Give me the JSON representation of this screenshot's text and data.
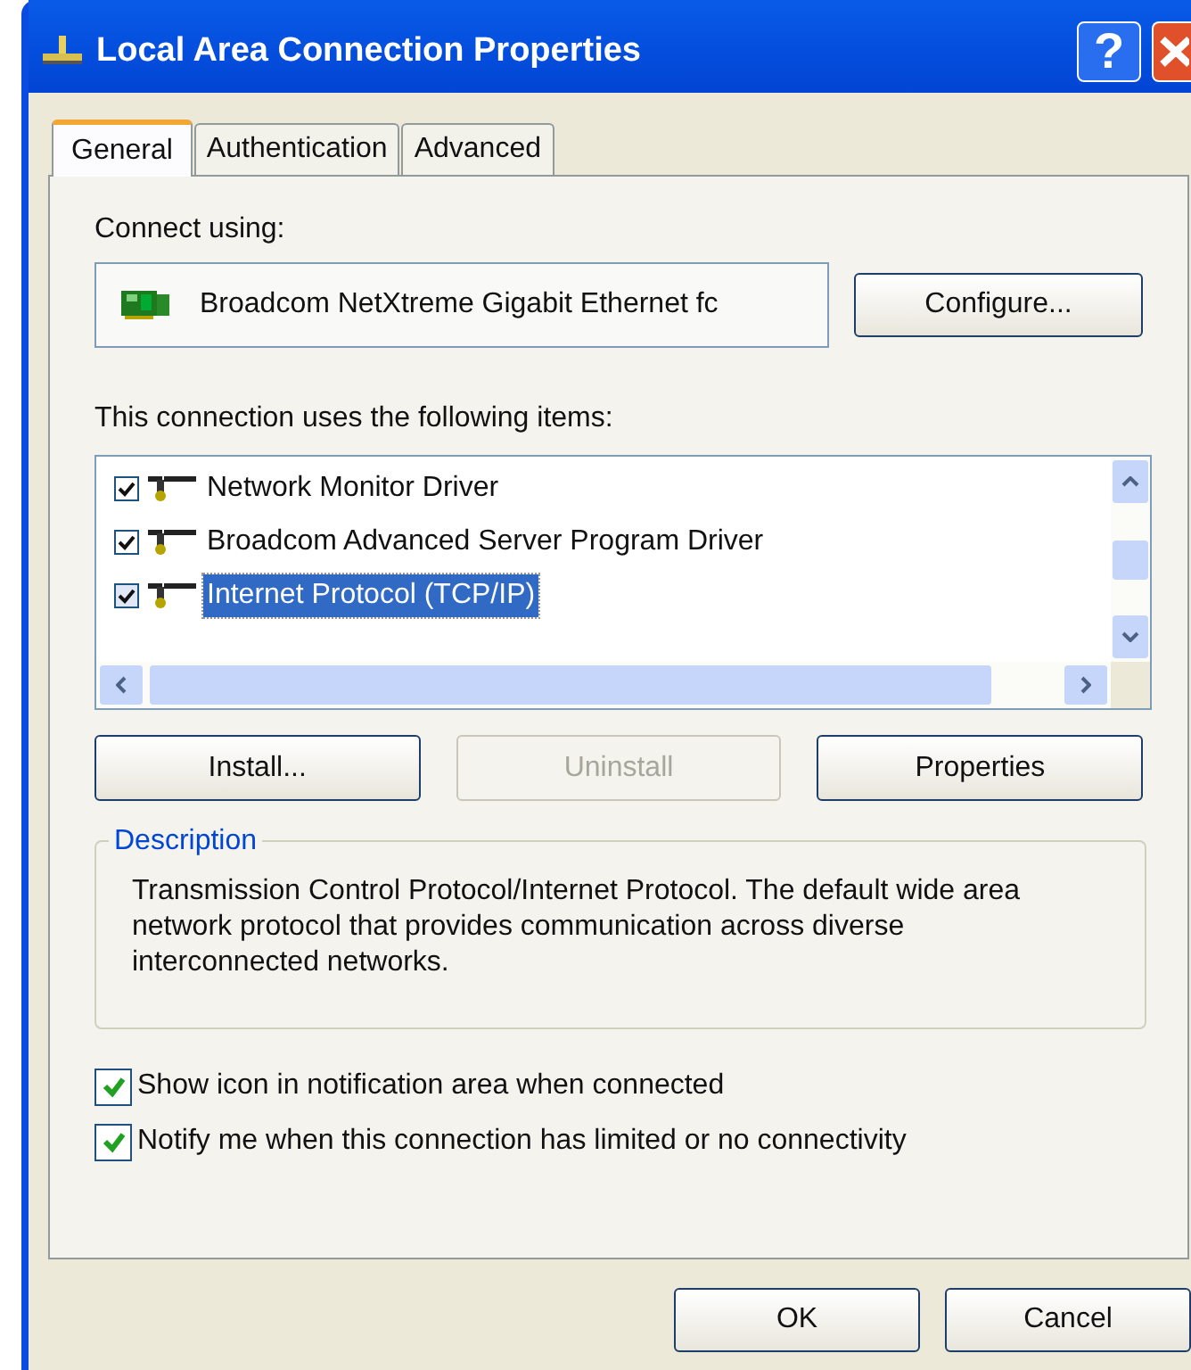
{
  "window": {
    "title": "Local Area Connection Properties",
    "help": "?"
  },
  "tabs": [
    {
      "label": "General",
      "selected": true
    },
    {
      "label": "Authentication",
      "selected": false
    },
    {
      "label": "Advanced",
      "selected": false
    }
  ],
  "connect_using": {
    "label": "Connect using:",
    "adapter": "Broadcom NetXtreme Gigabit Ethernet fc",
    "button": "Configure..."
  },
  "items_label": "This connection uses the following items:",
  "items": [
    {
      "name": "Network Monitor Driver",
      "checked": true,
      "selected": false
    },
    {
      "name": "Broadcom Advanced Server Program Driver",
      "checked": true,
      "selected": false
    },
    {
      "name": "Internet Protocol (TCP/IP)",
      "checked": true,
      "selected": true
    }
  ],
  "item_buttons": [
    {
      "label": "Install...",
      "disabled": false
    },
    {
      "label": "Uninstall",
      "disabled": true
    },
    {
      "label": "Properties",
      "disabled": false
    }
  ],
  "description": {
    "title": "Description",
    "text": "Transmission Control Protocol/Internet Protocol. The default wide area network protocol that provides communication across diverse interconnected networks."
  },
  "options": [
    {
      "label": "Show icon in notification area when connected",
      "checked": true
    },
    {
      "label": "Notify me when this connection has limited or no connectivity",
      "checked": true
    }
  ],
  "buttons": [
    "OK",
    "Cancel"
  ]
}
